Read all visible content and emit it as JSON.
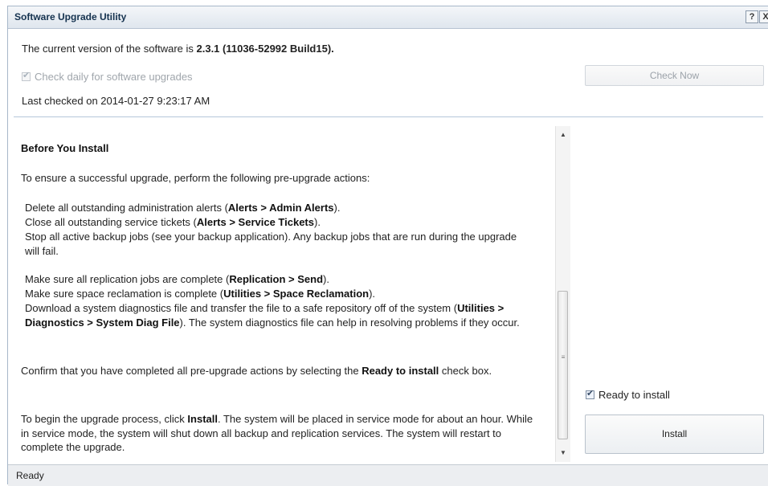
{
  "window": {
    "title": "Software Upgrade Utility",
    "help_label": "?",
    "close_label": "X"
  },
  "version": {
    "prefix": "The current version of the software is",
    "value": "2.3.1 (11036-52992 Build15)."
  },
  "check_daily": {
    "label": "Check daily for software upgrades",
    "checked": true,
    "enabled": false
  },
  "last_checked": "Last checked on 2014-01-27 9:23:17 AM",
  "check_now_label": "Check Now",
  "content": {
    "heading": "Before You Install",
    "intro": "To ensure a successful upgrade, perform the following pre-upgrade actions:",
    "actions": [
      {
        "text": "Delete all outstanding administration alerts (",
        "bold": "Alerts > Admin Alerts",
        "after": ")."
      },
      {
        "text": "Close all outstanding service tickets (",
        "bold": "Alerts > Service Tickets",
        "after": ")."
      },
      {
        "text": "Stop all active backup jobs (see your backup application). Any backup jobs that are run during the upgrade will fail.",
        "bold": "",
        "after": ""
      },
      {
        "text": "Make sure all replication jobs are complete (",
        "bold": "Replication > Send",
        "after": ")."
      },
      {
        "text": "Make sure space reclamation is complete (",
        "bold": "Utilities > Space Reclamation",
        "after": ")."
      },
      {
        "text": "Download a system diagnostics file and transfer the file to a safe repository off of the system (",
        "bold": "Utilities > Diagnostics > System Diag File",
        "after": "). The system diagnostics file can help in resolving problems if they occur."
      }
    ],
    "confirm_before": "Confirm that you have completed all pre-upgrade actions by selecting the",
    "confirm_bold": "Ready to install",
    "confirm_after": "check box.",
    "begin_before": "To begin the upgrade process, click",
    "begin_bold": "Install",
    "begin_after": ". The system will be placed in service mode for about an hour. While in service mode, the system will shut down all backup and replication services. The system will restart to complete the upgrade."
  },
  "scrollbar": {
    "up_arrow": "▲",
    "down_arrow": "▼",
    "grip": "≡"
  },
  "ready_to_install": {
    "label": "Ready to install",
    "checked": true
  },
  "install_label": "Install",
  "status": "Ready"
}
